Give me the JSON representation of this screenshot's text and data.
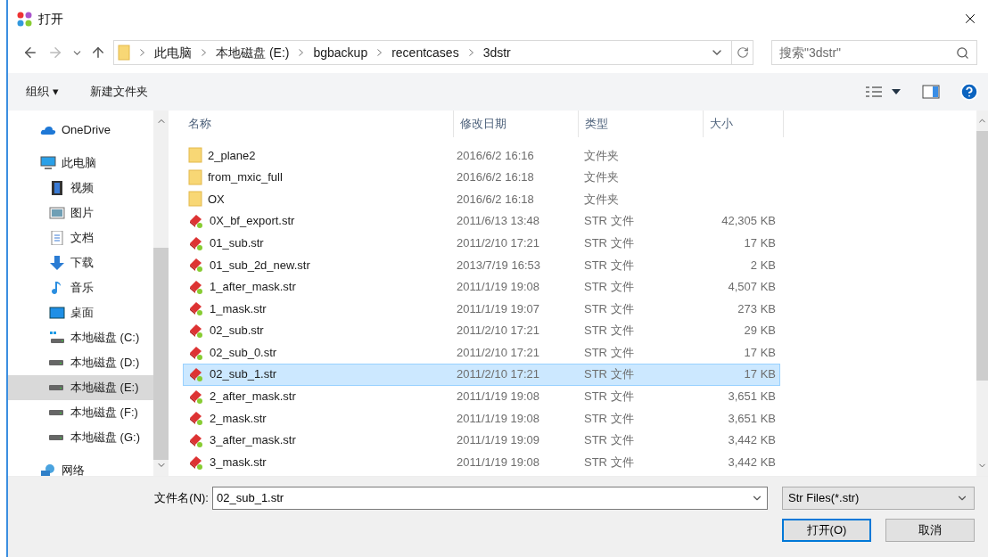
{
  "window": {
    "title": "打开"
  },
  "address": {
    "crumbs": [
      "此电脑",
      "本地磁盘 (E:)",
      "bgbackup",
      "recentcases",
      "3dstr"
    ]
  },
  "search": {
    "placeholder": "搜索\"3dstr\""
  },
  "toolbar": {
    "organize": "组织 ▾",
    "new_folder": "新建文件夹"
  },
  "sidebar": {
    "items": [
      {
        "label": "OneDrive",
        "kind": "cloud",
        "selected": false
      },
      {
        "label": "此电脑",
        "kind": "pc",
        "selected": false,
        "children": [
          {
            "label": "视频",
            "kind": "video",
            "selected": false
          },
          {
            "label": "图片",
            "kind": "pictures",
            "selected": false
          },
          {
            "label": "文档",
            "kind": "documents",
            "selected": false
          },
          {
            "label": "下载",
            "kind": "download",
            "selected": false
          },
          {
            "label": "音乐",
            "kind": "music",
            "selected": false
          },
          {
            "label": "桌面",
            "kind": "desktop",
            "selected": false
          },
          {
            "label": "本地磁盘 (C:)",
            "kind": "system-drive",
            "selected": false
          },
          {
            "label": "本地磁盘 (D:)",
            "kind": "drive",
            "selected": false
          },
          {
            "label": "本地磁盘 (E:)",
            "kind": "drive",
            "selected": true
          },
          {
            "label": "本地磁盘 (F:)",
            "kind": "drive",
            "selected": false
          },
          {
            "label": "本地磁盘 (G:)",
            "kind": "drive",
            "selected": false
          }
        ]
      },
      {
        "label": "网络",
        "kind": "network",
        "selected": false
      }
    ]
  },
  "table": {
    "columns": [
      "名称",
      "修改日期",
      "类型",
      "大小"
    ],
    "rows": [
      {
        "name": "2_plane2",
        "date": "2016/6/2 16:16",
        "type": "文件夹",
        "size": "",
        "kind": "folder",
        "selected": false
      },
      {
        "name": "from_mxic_full",
        "date": "2016/6/2 16:18",
        "type": "文件夹",
        "size": "",
        "kind": "folder",
        "selected": false
      },
      {
        "name": "OX",
        "date": "2016/6/2 16:18",
        "type": "文件夹",
        "size": "",
        "kind": "folder",
        "selected": false
      },
      {
        "name": "0X_bf_export.str",
        "date": "2011/6/13 13:48",
        "type": "STR 文件",
        "size": "42,305 KB",
        "kind": "file",
        "selected": false
      },
      {
        "name": "01_sub.str",
        "date": "2011/2/10 17:21",
        "type": "STR 文件",
        "size": "17 KB",
        "kind": "file",
        "selected": false
      },
      {
        "name": "01_sub_2d_new.str",
        "date": "2013/7/19 16:53",
        "type": "STR 文件",
        "size": "2 KB",
        "kind": "file",
        "selected": false
      },
      {
        "name": "1_after_mask.str",
        "date": "2011/1/19 19:08",
        "type": "STR 文件",
        "size": "4,507 KB",
        "kind": "file",
        "selected": false
      },
      {
        "name": "1_mask.str",
        "date": "2011/1/19 19:07",
        "type": "STR 文件",
        "size": "273 KB",
        "kind": "file",
        "selected": false
      },
      {
        "name": "02_sub.str",
        "date": "2011/2/10 17:21",
        "type": "STR 文件",
        "size": "29 KB",
        "kind": "file",
        "selected": false
      },
      {
        "name": "02_sub_0.str",
        "date": "2011/2/10 17:21",
        "type": "STR 文件",
        "size": "17 KB",
        "kind": "file",
        "selected": false
      },
      {
        "name": "02_sub_1.str",
        "date": "2011/2/10 17:21",
        "type": "STR 文件",
        "size": "17 KB",
        "kind": "file",
        "selected": true
      },
      {
        "name": "2_after_mask.str",
        "date": "2011/1/19 19:08",
        "type": "STR 文件",
        "size": "3,651 KB",
        "kind": "file",
        "selected": false
      },
      {
        "name": "2_mask.str",
        "date": "2011/1/19 19:08",
        "type": "STR 文件",
        "size": "3,651 KB",
        "kind": "file",
        "selected": false
      },
      {
        "name": "3_after_mask.str",
        "date": "2011/1/19 19:09",
        "type": "STR 文件",
        "size": "3,442 KB",
        "kind": "file",
        "selected": false
      },
      {
        "name": "3_mask.str",
        "date": "2011/1/19 19:08",
        "type": "STR 文件",
        "size": "3,442 KB",
        "kind": "file",
        "selected": false
      }
    ]
  },
  "footer": {
    "filename_label": "文件名(N):",
    "filename": "02_sub_1.str",
    "filter": "Str Files(*.str)",
    "open": "打开(O)",
    "cancel": "取消"
  }
}
